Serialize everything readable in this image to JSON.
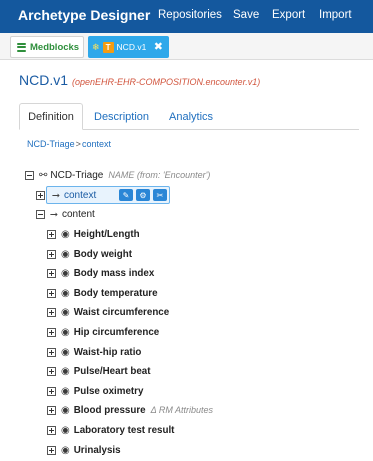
{
  "navbar": {
    "brand": "Archetype Designer",
    "menu": [
      "Repositories",
      "Save",
      "Export",
      "Import"
    ]
  },
  "doc_tabs": {
    "medblocks_label": "Medblocks",
    "file_badge": "T",
    "file_label": "NCD.v1",
    "close_glyph": "✖"
  },
  "page": {
    "title": "NCD.v1",
    "subtitle": "(openEHR-EHR-COMPOSITION.encounter.v1)"
  },
  "tabs": [
    "Definition",
    "Description",
    "Analytics"
  ],
  "breadcrumb": {
    "parent": "NCD-Triage",
    "separator": ">",
    "current": "context"
  },
  "tree": {
    "root": {
      "label": "NCD-Triage",
      "hint": "NAME (from: 'Encounter')"
    },
    "context": {
      "label": "context"
    },
    "content": {
      "label": "content"
    },
    "items": [
      {
        "label": "Height/Length",
        "hint": ""
      },
      {
        "label": "Body weight",
        "hint": ""
      },
      {
        "label": "Body mass index",
        "hint": ""
      },
      {
        "label": "Body temperature",
        "hint": ""
      },
      {
        "label": "Waist circumference",
        "hint": ""
      },
      {
        "label": "Hip circumference",
        "hint": ""
      },
      {
        "label": "Waist-hip ratio",
        "hint": ""
      },
      {
        "label": "Pulse/Heart beat",
        "hint": ""
      },
      {
        "label": "Pulse oximetry",
        "hint": ""
      },
      {
        "label": "Blood pressure",
        "hint": "Δ RM Attributes"
      },
      {
        "label": "Laboratory test result",
        "hint": ""
      },
      {
        "label": "Urinalysis",
        "hint": ""
      }
    ]
  },
  "colors": {
    "navbar": "#14589e",
    "file_tab": "#2ea8ea",
    "medblocks_green": "#2f8f3c",
    "link_blue": "#1f6fbf",
    "subtitle_red": "#d2563f"
  }
}
